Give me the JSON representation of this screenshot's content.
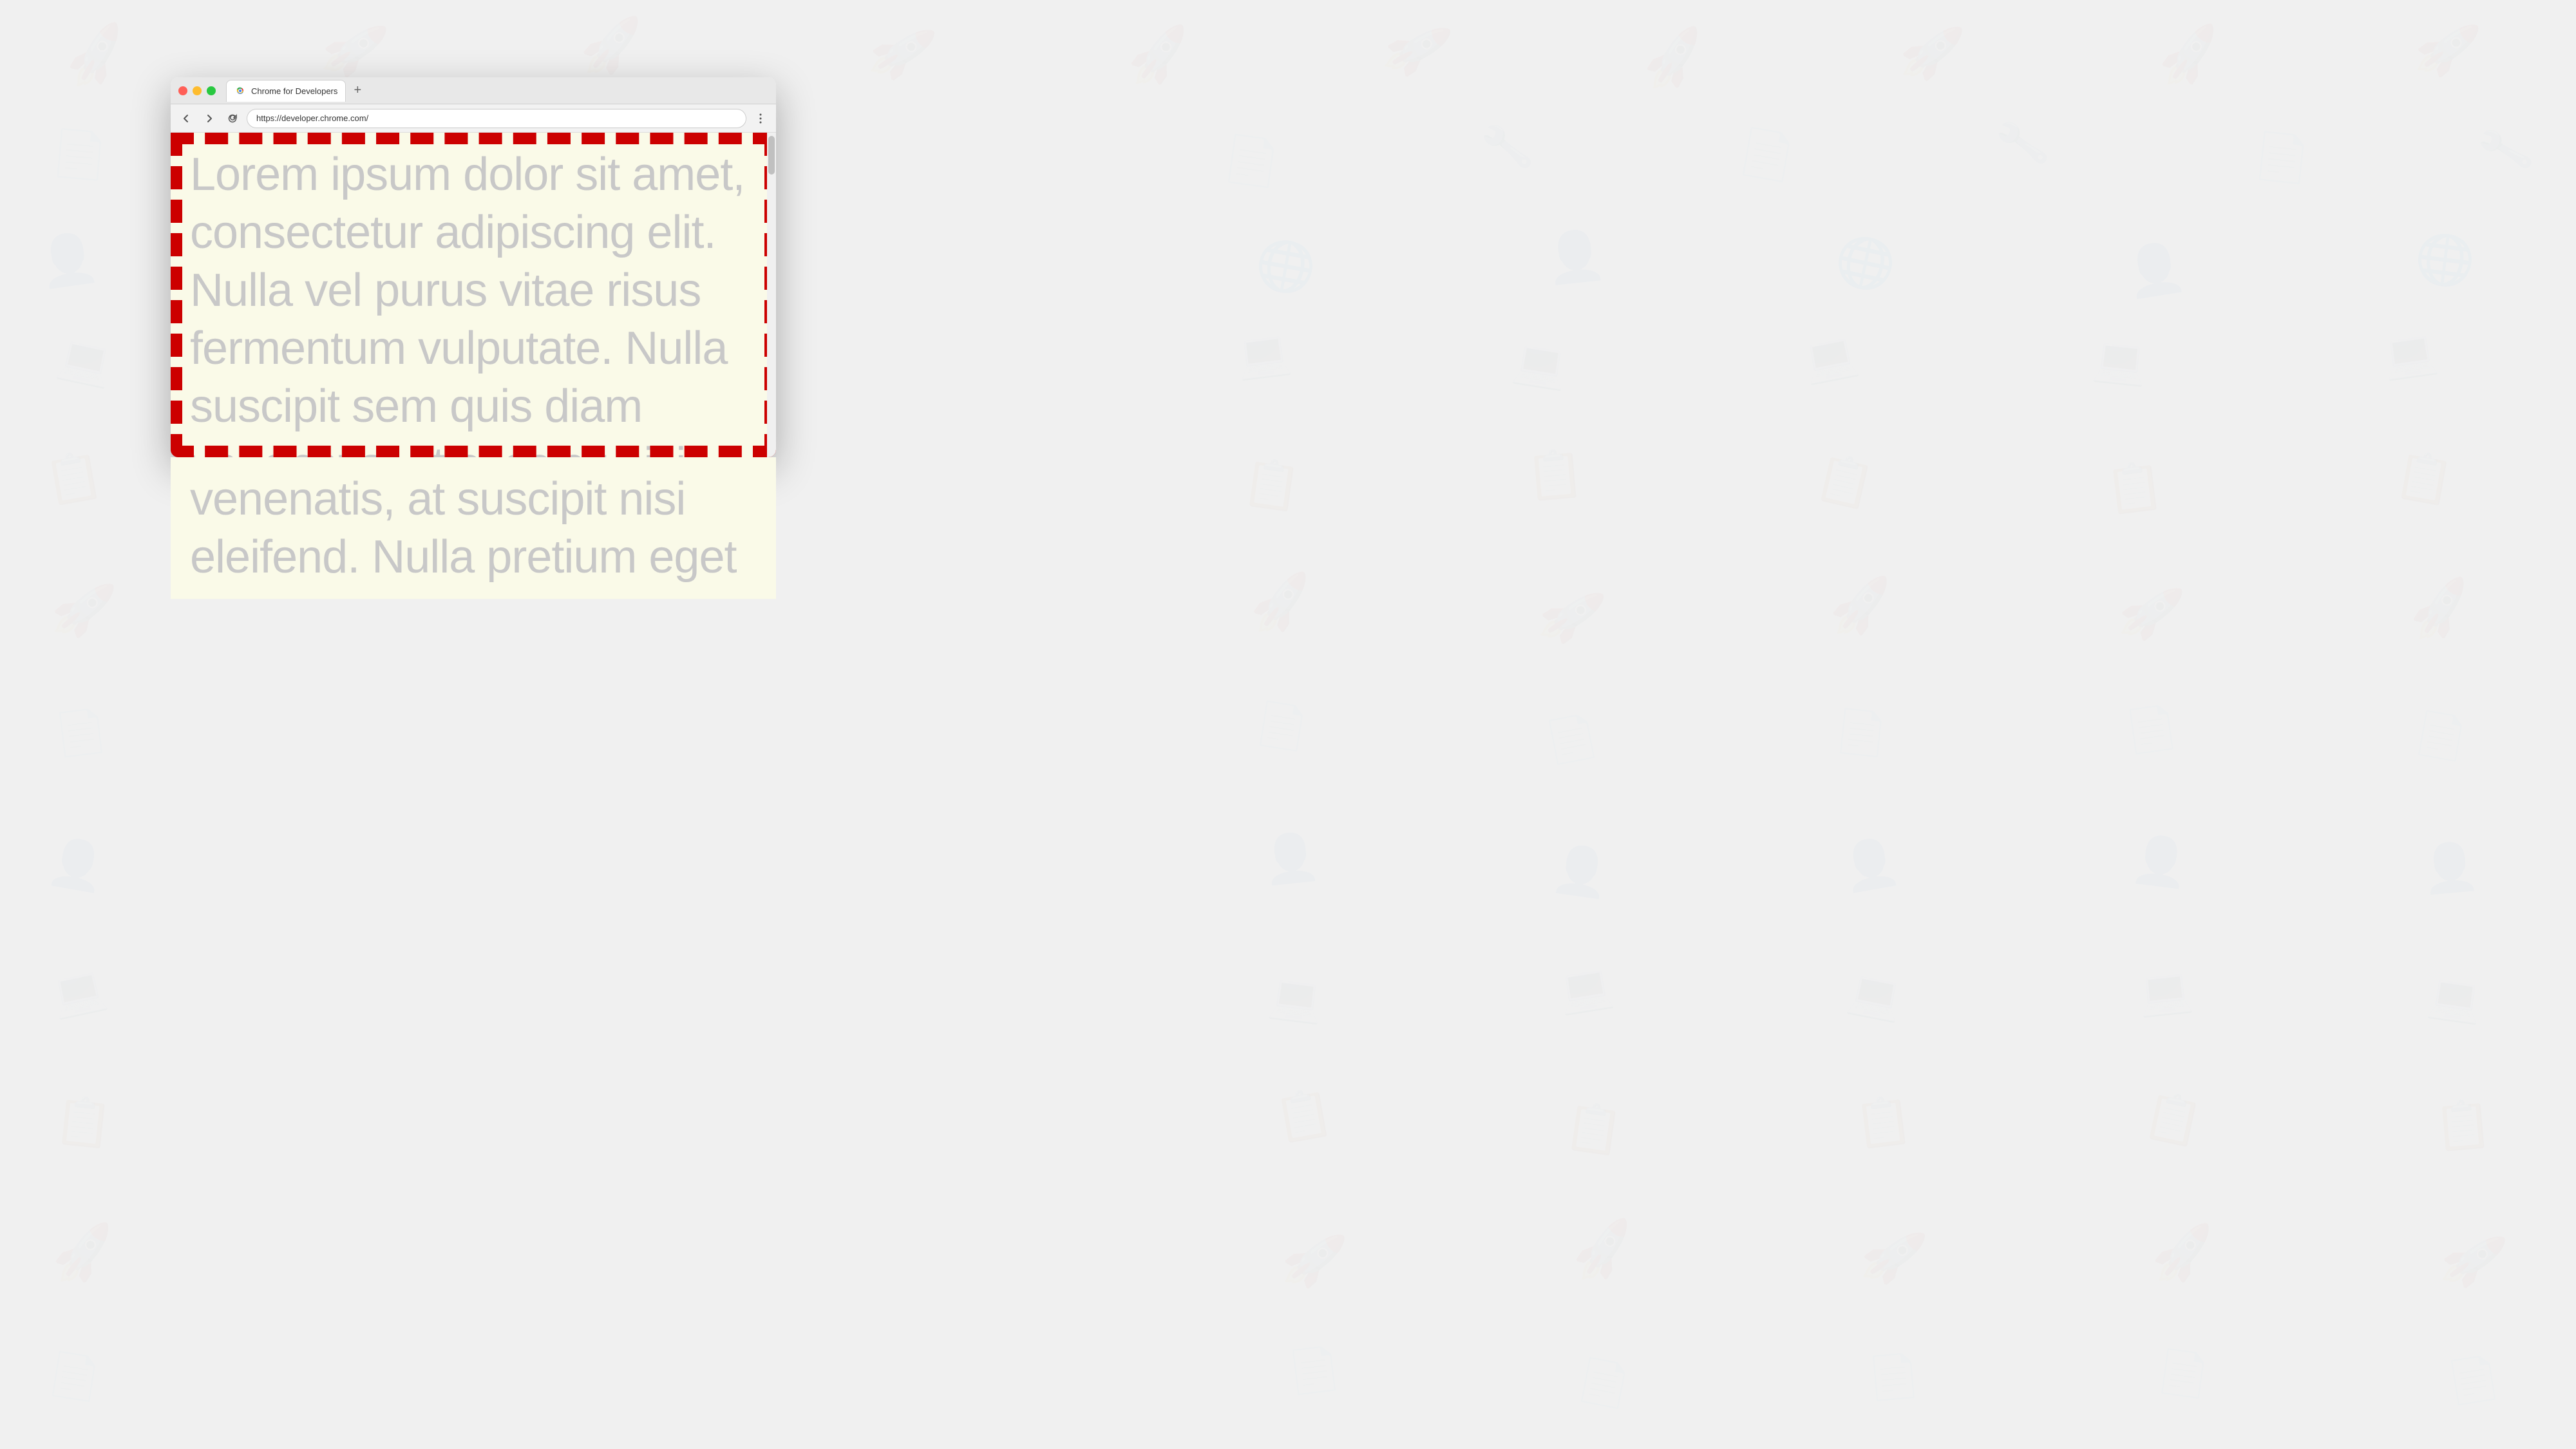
{
  "background": {
    "color": "#f0f0f0"
  },
  "browser": {
    "title": "Chrome for Developers",
    "url": "https://developer.chrome.com/",
    "tab_label": "Chrome for Developers",
    "new_tab_label": "+",
    "back_btn": "←",
    "forward_btn": "→",
    "reload_btn": "↻",
    "more_btn": "⋮"
  },
  "page": {
    "background_color": "#fafae8",
    "border_color": "#cc0000",
    "lorem_text_visible": "Lorem ipsum dolor sit amet, consectetur adipiscing elit. Nulla vel purus vitae risus fermentum vulputate. Nulla suscipit sem quis diam venenatis, at suscipit nisi eleifend. Nulla pretium eget",
    "lorem_text_below": "venenatis, at suscipit nisi eleifend. Nulla pretium eget",
    "text_color": "#c8c8c8"
  }
}
